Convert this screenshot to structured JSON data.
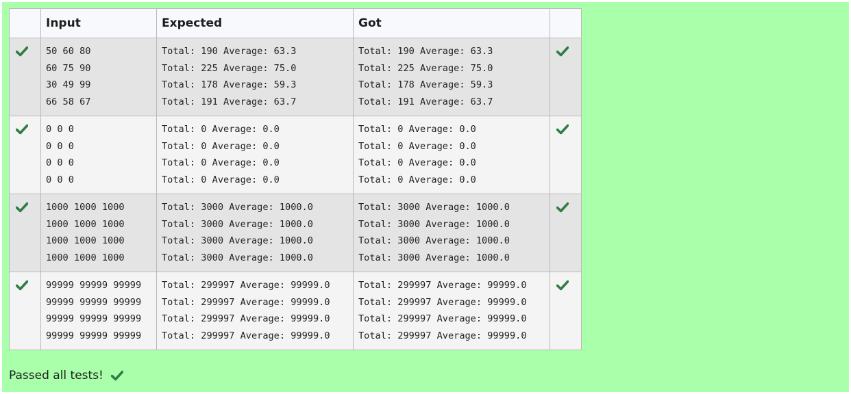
{
  "table": {
    "headers": [
      "",
      "Input",
      "Expected",
      "Got",
      ""
    ],
    "rows": [
      {
        "status": "pass",
        "input": [
          "50 60 80",
          "60 75 90",
          "30 49 99",
          "66 58 67"
        ],
        "expected": [
          "Total: 190 Average: 63.3",
          "Total: 225 Average: 75.0",
          "Total: 178 Average: 59.3",
          "Total: 191 Average: 63.7"
        ],
        "got": [
          "Total: 190 Average: 63.3",
          "Total: 225 Average: 75.0",
          "Total: 178 Average: 59.3",
          "Total: 191 Average: 63.7"
        ]
      },
      {
        "status": "pass",
        "input": [
          "0 0 0",
          "0 0 0",
          "0 0 0",
          "0 0 0"
        ],
        "expected": [
          "Total: 0 Average: 0.0",
          "Total: 0 Average: 0.0",
          "Total: 0 Average: 0.0",
          "Total: 0 Average: 0.0"
        ],
        "got": [
          "Total: 0 Average: 0.0",
          "Total: 0 Average: 0.0",
          "Total: 0 Average: 0.0",
          "Total: 0 Average: 0.0"
        ]
      },
      {
        "status": "pass",
        "input": [
          "1000 1000 1000",
          "1000 1000 1000",
          "1000 1000 1000",
          "1000 1000 1000"
        ],
        "expected": [
          "Total: 3000 Average: 1000.0",
          "Total: 3000 Average: 1000.0",
          "Total: 3000 Average: 1000.0",
          "Total: 3000 Average: 1000.0"
        ],
        "got": [
          "Total: 3000 Average: 1000.0",
          "Total: 3000 Average: 1000.0",
          "Total: 3000 Average: 1000.0",
          "Total: 3000 Average: 1000.0"
        ]
      },
      {
        "status": "pass",
        "input": [
          "99999 99999 99999",
          "99999 99999 99999",
          "99999 99999 99999",
          "99999 99999 99999"
        ],
        "expected": [
          "Total: 299997 Average: 99999.0",
          "Total: 299997 Average: 99999.0",
          "Total: 299997 Average: 99999.0",
          "Total: 299997 Average: 99999.0"
        ],
        "got": [
          "Total: 299997 Average: 99999.0",
          "Total: 299997 Average: 99999.0",
          "Total: 299997 Average: 99999.0",
          "Total: 299997 Average: 99999.0"
        ]
      }
    ]
  },
  "summary": {
    "text": "Passed all tests!",
    "icon": "check-icon"
  },
  "colors": {
    "page_background": "#aaffaa",
    "header_background": "#f8f9fd",
    "row_odd": "#e4e4e4",
    "row_even": "#f4f4f4",
    "check_green": "#2e7d43",
    "border": "#b9b9b9"
  }
}
